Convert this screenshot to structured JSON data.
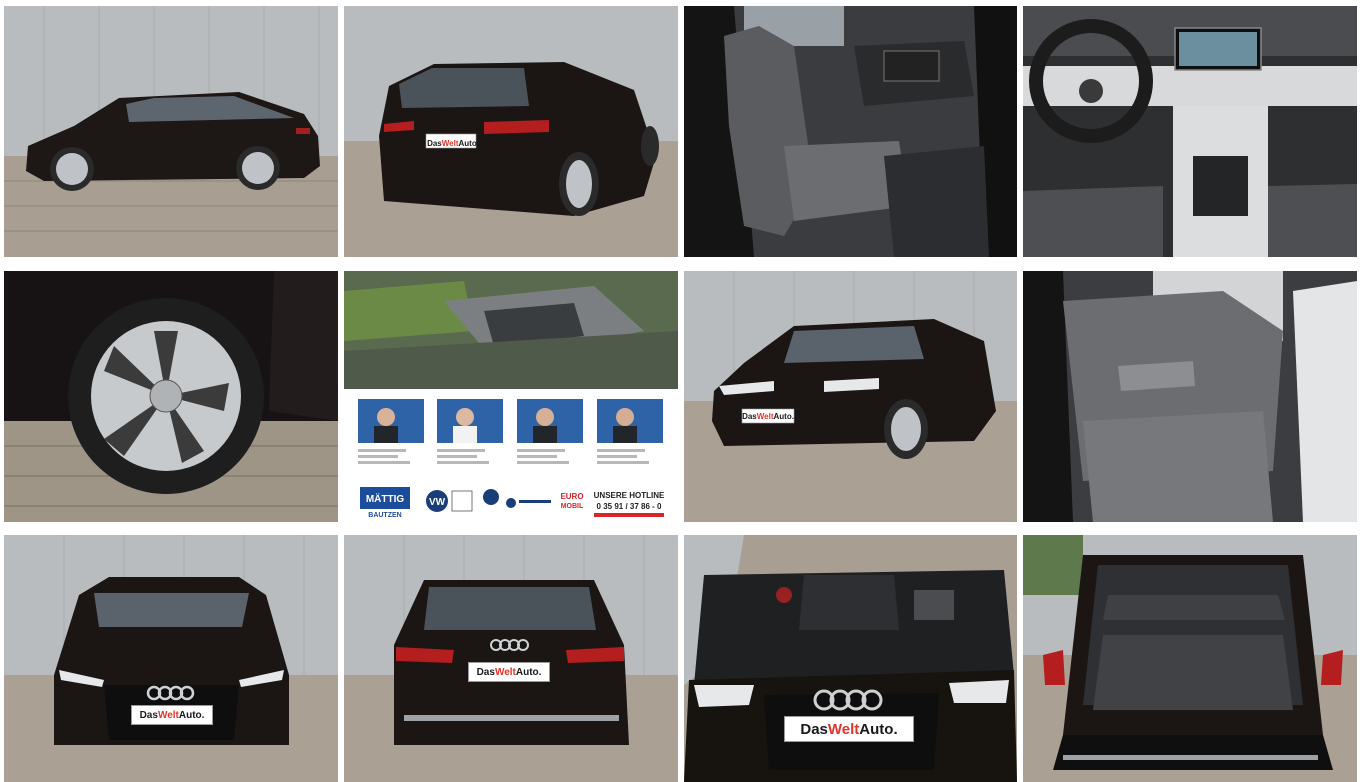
{
  "brand": {
    "plate_das": "Das",
    "plate_welt": "Welt",
    "plate_auto": "Auto.",
    "welt_color": "#e3342a",
    "text_color": "#1a1a1a"
  },
  "dealer": {
    "logo_line1": "MÄTTIG",
    "logo_line2": "BAUTZEN",
    "hotline_title": "UNSERE HOTLINE",
    "hotline_number": "0 35 91 / 37 86 - 0",
    "euro_label": "EURO",
    "euro_sub": "MOBIL"
  },
  "tiles": [
    {
      "name": "side-view"
    },
    {
      "name": "rear-three-quarter"
    },
    {
      "name": "front-seats"
    },
    {
      "name": "cockpit"
    },
    {
      "name": "wheel"
    },
    {
      "name": "dealer-info"
    },
    {
      "name": "front-three-quarter"
    },
    {
      "name": "rear-seats"
    },
    {
      "name": "front-view"
    },
    {
      "name": "rear-view"
    },
    {
      "name": "engine-bay"
    },
    {
      "name": "trunk"
    }
  ]
}
